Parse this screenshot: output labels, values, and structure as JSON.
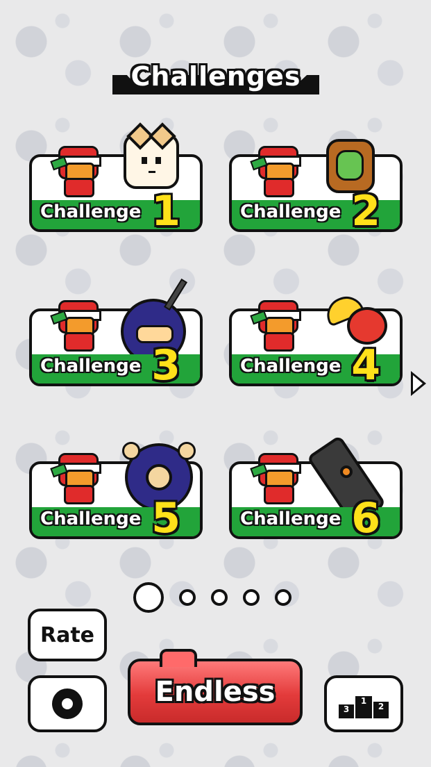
{
  "header": {
    "title": "Challenges"
  },
  "challenges": [
    {
      "label": "Challenge",
      "number": "1",
      "monster": "cat-icon"
    },
    {
      "label": "Challenge",
      "number": "2",
      "monster": "frame-monster-icon"
    },
    {
      "label": "Challenge",
      "number": "3",
      "monster": "ninja-bomb-icon"
    },
    {
      "label": "Challenge",
      "number": "4",
      "monster": "fruit-icon"
    },
    {
      "label": "Challenge",
      "number": "5",
      "monster": "wheel-icon"
    },
    {
      "label": "Challenge",
      "number": "6",
      "monster": "cannon-icon"
    }
  ],
  "pagination": {
    "current_page": 1,
    "total_pages": 5
  },
  "buttons": {
    "rate_label": "Rate",
    "endless_label": "Endless",
    "settings_icon": "gear-icon",
    "leaderboard_icon": "podium-icon",
    "podium_ranks": [
      "3",
      "1",
      "2"
    ]
  },
  "colors": {
    "accent_green": "#22a43a",
    "number_yellow": "#ffe11a",
    "endless_red": "#e33b3b",
    "outline": "#111111"
  }
}
